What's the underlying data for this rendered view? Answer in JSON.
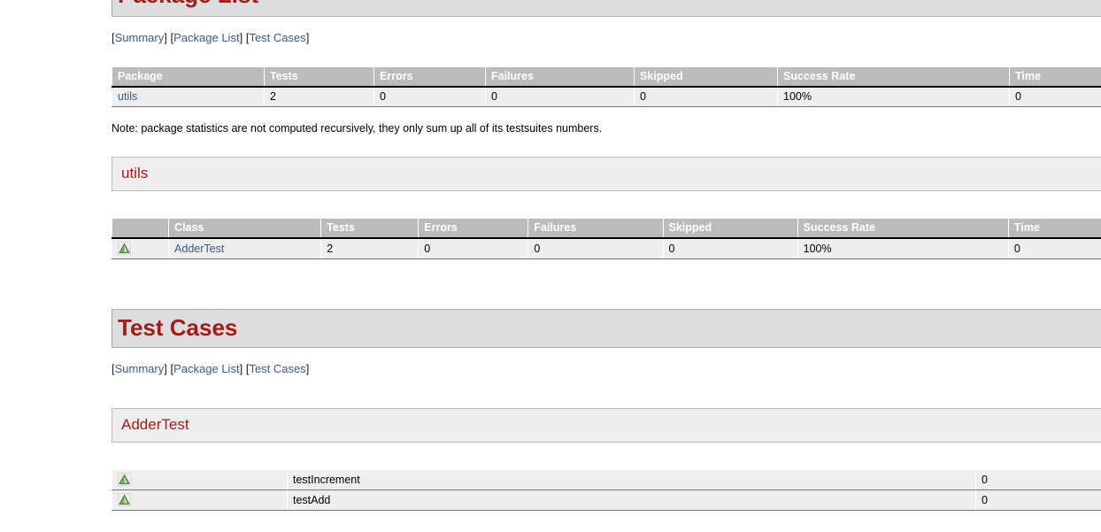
{
  "report": {
    "link_color": "#3b5b86",
    "heading_color": "#a51b1b",
    "header_bg": "#bbbbbb",
    "row_bg": "#eeeeee",
    "banner_bg": "#dddddd"
  },
  "package_list_section": {
    "heading": "Package List",
    "nav": {
      "open": "[",
      "close": "]",
      "summary": "Summary",
      "package_list": "Package List",
      "test_cases": "Test Cases"
    },
    "table": {
      "columns": [
        "Package",
        "Tests",
        "Errors",
        "Failures",
        "Skipped",
        "Success Rate",
        "Time"
      ],
      "rows": [
        {
          "package": "utils",
          "tests": "2",
          "errors": "0",
          "failures": "0",
          "skipped": "0",
          "success_rate": "100%",
          "time": "0"
        }
      ]
    },
    "note": "Note: package statistics are not computed recursively, they only sum up all of its testsuites numbers."
  },
  "package_detail": {
    "name": "utils",
    "table": {
      "columns": [
        "",
        "Class",
        "Tests",
        "Errors",
        "Failures",
        "Skipped",
        "Success Rate",
        "Time"
      ],
      "rows": [
        {
          "status_icon": "pass-icon",
          "class_name": "AdderTest",
          "tests": "2",
          "errors": "0",
          "failures": "0",
          "skipped": "0",
          "success_rate": "100%",
          "time": "0"
        }
      ]
    }
  },
  "test_cases_section": {
    "heading": "Test Cases",
    "nav": {
      "open": "[",
      "close": "]",
      "summary": "Summary",
      "package_list": "Package List",
      "test_cases": "Test Cases"
    },
    "suite": {
      "name": "AdderTest",
      "rows": [
        {
          "status_icon": "pass-icon",
          "name": "testIncrement",
          "time": "0"
        },
        {
          "status_icon": "pass-icon",
          "name": "testAdd",
          "time": "0"
        }
      ]
    }
  }
}
